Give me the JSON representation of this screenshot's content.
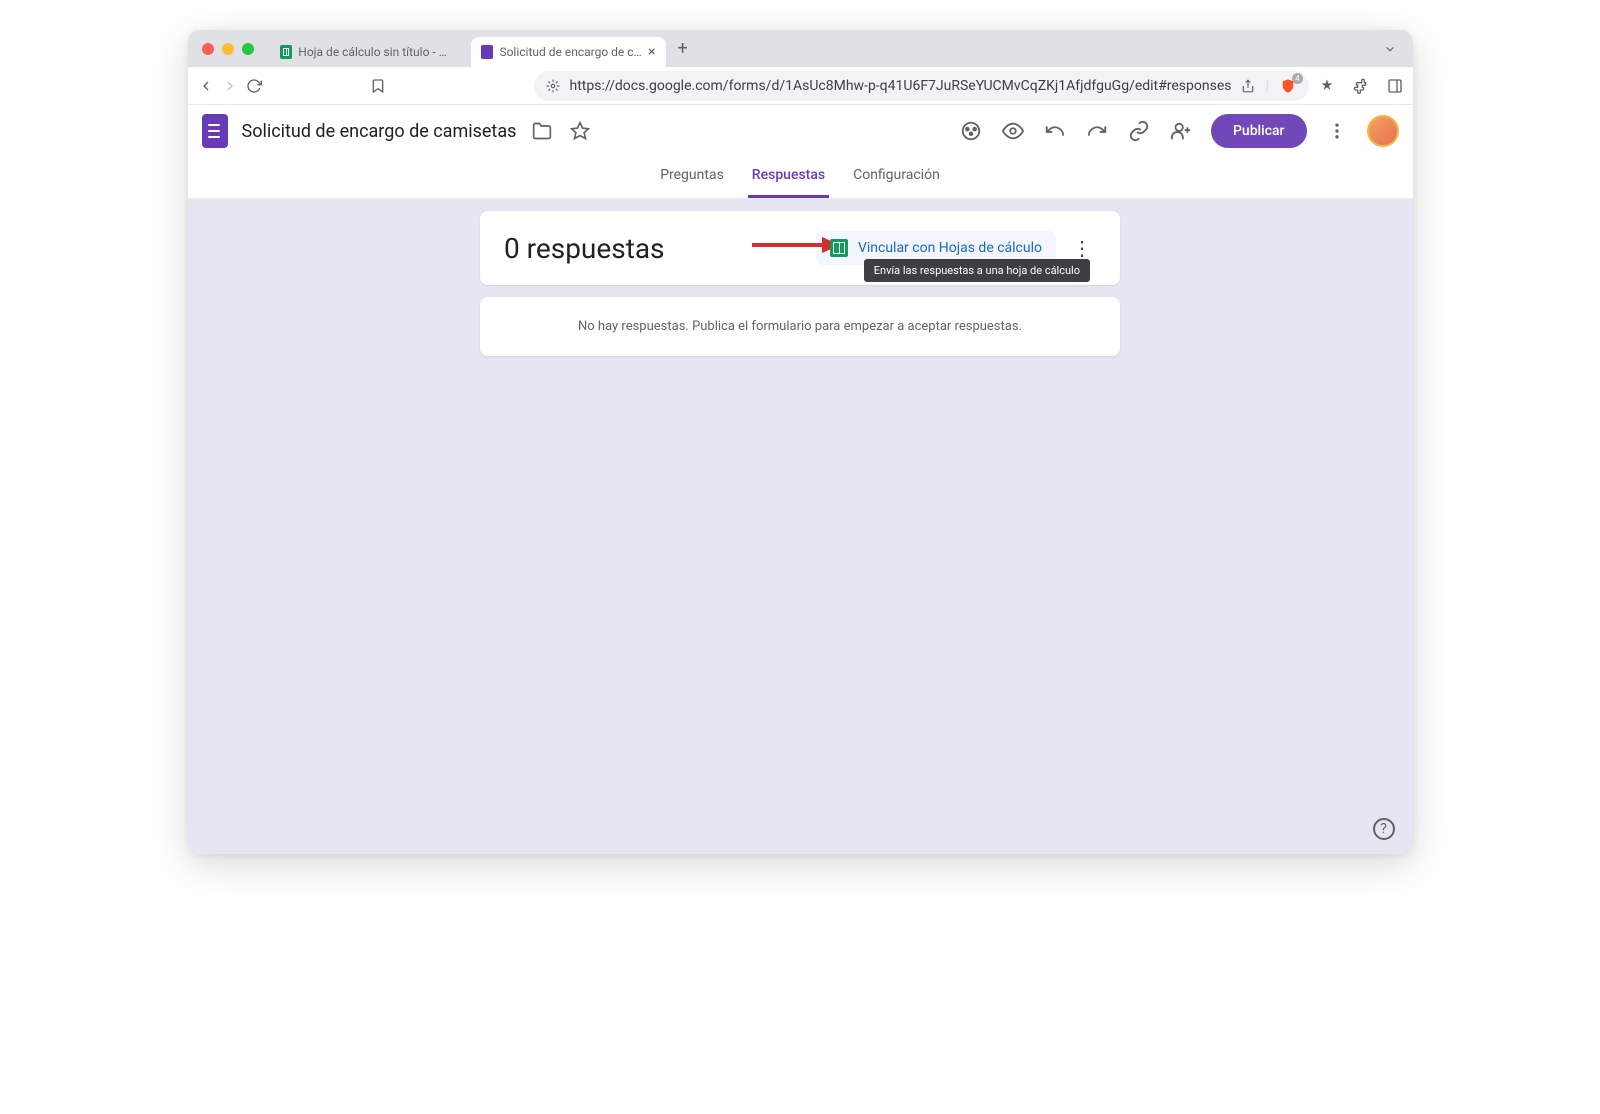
{
  "browser": {
    "tabs": [
      {
        "title": "Hoja de cálculo sin título - Hojas",
        "icon": "sheets"
      },
      {
        "title": "Solicitud de encargo de cami",
        "icon": "forms",
        "active": true
      }
    ],
    "url": "https://docs.google.com/forms/d/1AsUc8Mhw-p-q41U6F7JuRSeYUCMvCqZKj1AfjdfguGg/edit#responses",
    "shield_count": "4"
  },
  "header": {
    "doc_title": "Solicitud de encargo de camisetas",
    "publish_label": "Publicar"
  },
  "tabs": {
    "questions": "Preguntas",
    "responses": "Respuestas",
    "settings": "Configuración"
  },
  "responses": {
    "count_label": "0 respuestas",
    "link_sheets_label": "Vincular con Hojas de cálculo",
    "tooltip": "Envía las respuestas a una hoja de cálculo",
    "empty_message": "No hay respuestas. Publica el formulario para empezar a aceptar respuestas."
  }
}
